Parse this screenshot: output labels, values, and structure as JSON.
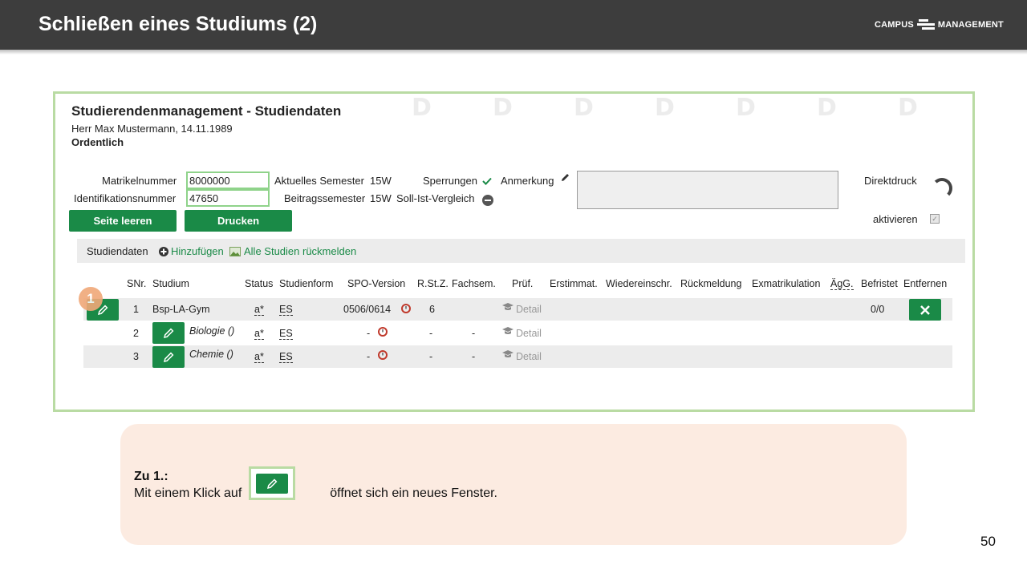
{
  "slide": {
    "title": "Schließen eines Studiums (2)",
    "page_number": "50"
  },
  "logo": {
    "left": "CAMPUS",
    "right": "MANAGEMENT"
  },
  "screen": {
    "title": "Studierendenmanagement - Studiendaten",
    "person": {
      "salutation": "Herr",
      "name": "Max Mustermann",
      "date": ", 14.11.1989",
      "status": "Ordentlich"
    },
    "fields": {
      "matrikel_label": "Matrikelnummer",
      "matrikel_value": "8000000",
      "ident_label": "Identifikationsnummer",
      "ident_value": "47650",
      "akt_sem_label": "Aktuelles Semester",
      "akt_sem_value": "15W",
      "beitrag_label": "Beitragssemester",
      "beitrag_value": "15W",
      "sperrungen": "Sperrungen",
      "soll_ist": "Soll-Ist-Vergleich",
      "anmerkung": "Anmerkung",
      "direktdruck": "Direktdruck",
      "aktivieren": "aktivieren"
    },
    "buttons": {
      "clear": "Seite leeren",
      "print": "Drucken"
    },
    "toolbar": {
      "label": "Studiendaten",
      "add": "Hinzufügen",
      "all": "Alle Studien rückmelden"
    },
    "columns": [
      "SNr.",
      "Studium",
      "Status",
      "Studienform",
      "SPO-Version",
      "R.St.Z.",
      "Fachsem.",
      "Prüf.",
      "Erstimmat.",
      "Wiedereinschr.",
      "Rückmeldung",
      "Exmatrikulation",
      "ÄgG.",
      "Befristet",
      "Entfernen"
    ],
    "rows": [
      {
        "snr": "1",
        "studium": "Bsp-LA-Gym",
        "status": "a*",
        "form": "ES",
        "spo": "0506/0614",
        "rstz": "6",
        "fachsem": "",
        "pruef": "Detail",
        "befristet": "0/0"
      },
      {
        "snr": "2",
        "studium": "Biologie ()",
        "status": "a*",
        "form": "ES",
        "spo": "-",
        "rstz": "-",
        "fachsem": "-",
        "pruef": "Detail",
        "befristet": ""
      },
      {
        "snr": "3",
        "studium": "Chemie ()",
        "status": "a*",
        "form": "ES",
        "spo": "-",
        "rstz": "-",
        "fachsem": "-",
        "pruef": "Detail",
        "befristet": ""
      }
    ]
  },
  "badge": "1",
  "note": {
    "title": "Zu 1.:",
    "text_before": "Mit einem Klick auf",
    "text_after": "öffnet sich ein neues Fenster."
  }
}
